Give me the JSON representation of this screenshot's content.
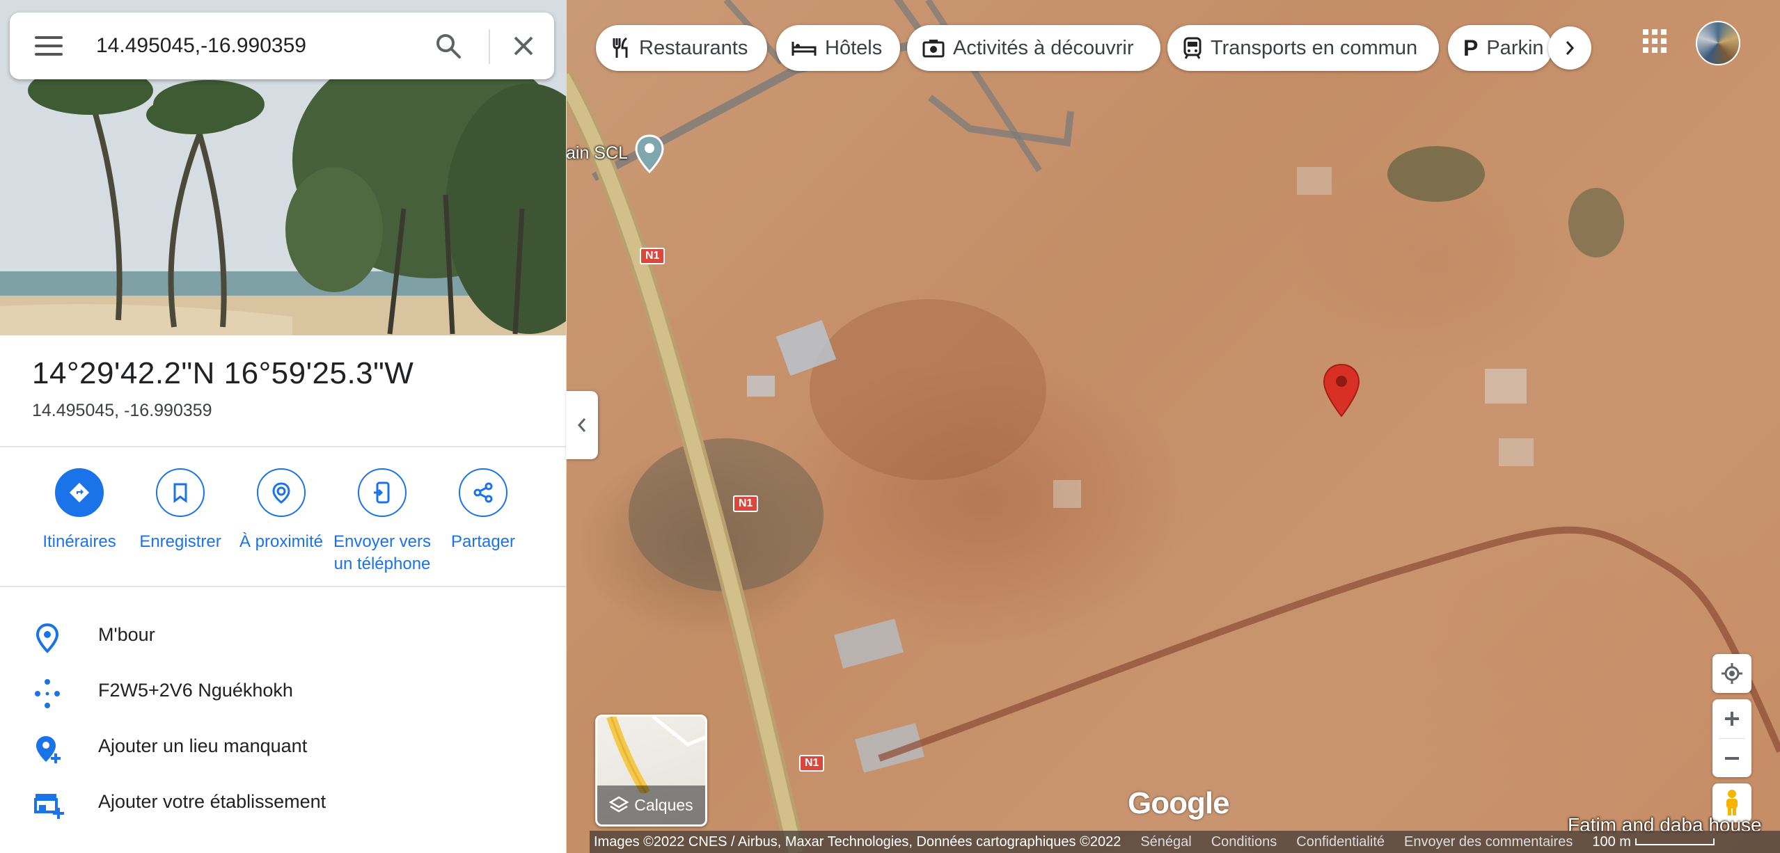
{
  "search": {
    "value": "14.495045,-16.990359"
  },
  "place": {
    "dms": "14°29'42.2\"N 16°59'25.3\"W",
    "decimal": "14.495045, -16.990359"
  },
  "actions": [
    {
      "label": "Itinéraires",
      "icon": "directions-icon"
    },
    {
      "label": "Enregistrer",
      "icon": "bookmark-icon"
    },
    {
      "label": "À proximité",
      "icon": "nearby-icon"
    },
    {
      "label_line1": "Envoyer vers",
      "label_line2": "un téléphone",
      "icon": "send-to-phone-icon"
    },
    {
      "label": "Partager",
      "icon": "share-icon"
    }
  ],
  "info": [
    {
      "text": "M'bour",
      "icon": "location-pin-icon"
    },
    {
      "text": "F2W5+2V6 Nguékhokh",
      "icon": "plus-code-icon"
    },
    {
      "text": "Ajouter un lieu manquant",
      "icon": "add-place-icon"
    },
    {
      "text": "Ajouter votre établissement",
      "icon": "add-business-icon"
    }
  ],
  "chips": [
    {
      "label": "Restaurants",
      "icon": "restaurant-icon"
    },
    {
      "label": "Hôtels",
      "icon": "hotel-icon"
    },
    {
      "label": "Activités à découvrir",
      "icon": "camera-icon"
    },
    {
      "label": "Transports en commun",
      "icon": "transit-icon"
    },
    {
      "label": "Parkin",
      "icon": "parking-icon"
    }
  ],
  "map": {
    "poi_label": "ain SCL",
    "road_label": "N1",
    "layers_label": "Calques",
    "logo": "Google",
    "place_label": "Fatim and daba house",
    "accent": "#1a73e8",
    "pin_color": "#d93025"
  },
  "footer": {
    "attribution": "Images ©2022 CNES / Airbus, Maxar Technologies, Données cartographiques ©2022",
    "country": "Sénégal",
    "terms": "Conditions",
    "privacy": "Confidentialité",
    "feedback": "Envoyer des commentaires",
    "scale": "100 m"
  }
}
